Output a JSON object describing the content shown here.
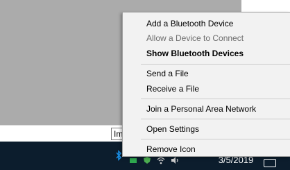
{
  "background": {
    "input_text": "Im"
  },
  "context_menu": {
    "items": [
      {
        "label": "Add a Bluetooth Device",
        "disabled": false,
        "bold": false
      },
      {
        "label": "Allow a Device to Connect",
        "disabled": true,
        "bold": false
      },
      {
        "label": "Show Bluetooth Devices",
        "disabled": false,
        "bold": true
      },
      {
        "label": "Send a File",
        "disabled": false,
        "bold": false
      },
      {
        "label": "Receive a File",
        "disabled": false,
        "bold": false
      },
      {
        "label": "Join a Personal Area Network",
        "disabled": false,
        "bold": false
      },
      {
        "label": "Open Settings",
        "disabled": false,
        "bold": false
      },
      {
        "label": "Remove Icon",
        "disabled": false,
        "bold": false
      }
    ]
  },
  "taskbar": {
    "clock_date": "3/5/2019",
    "tray_icons": [
      "bluetooth-icon",
      "network-icon",
      "security-icon",
      "wifi-icon",
      "volume-icon"
    ]
  },
  "colors": {
    "taskbar_bg": "#0c1d2d",
    "bluetooth_blue": "#1a8fe6",
    "menu_bg": "#f2f2f2",
    "disabled_text": "#6d6d6d"
  }
}
